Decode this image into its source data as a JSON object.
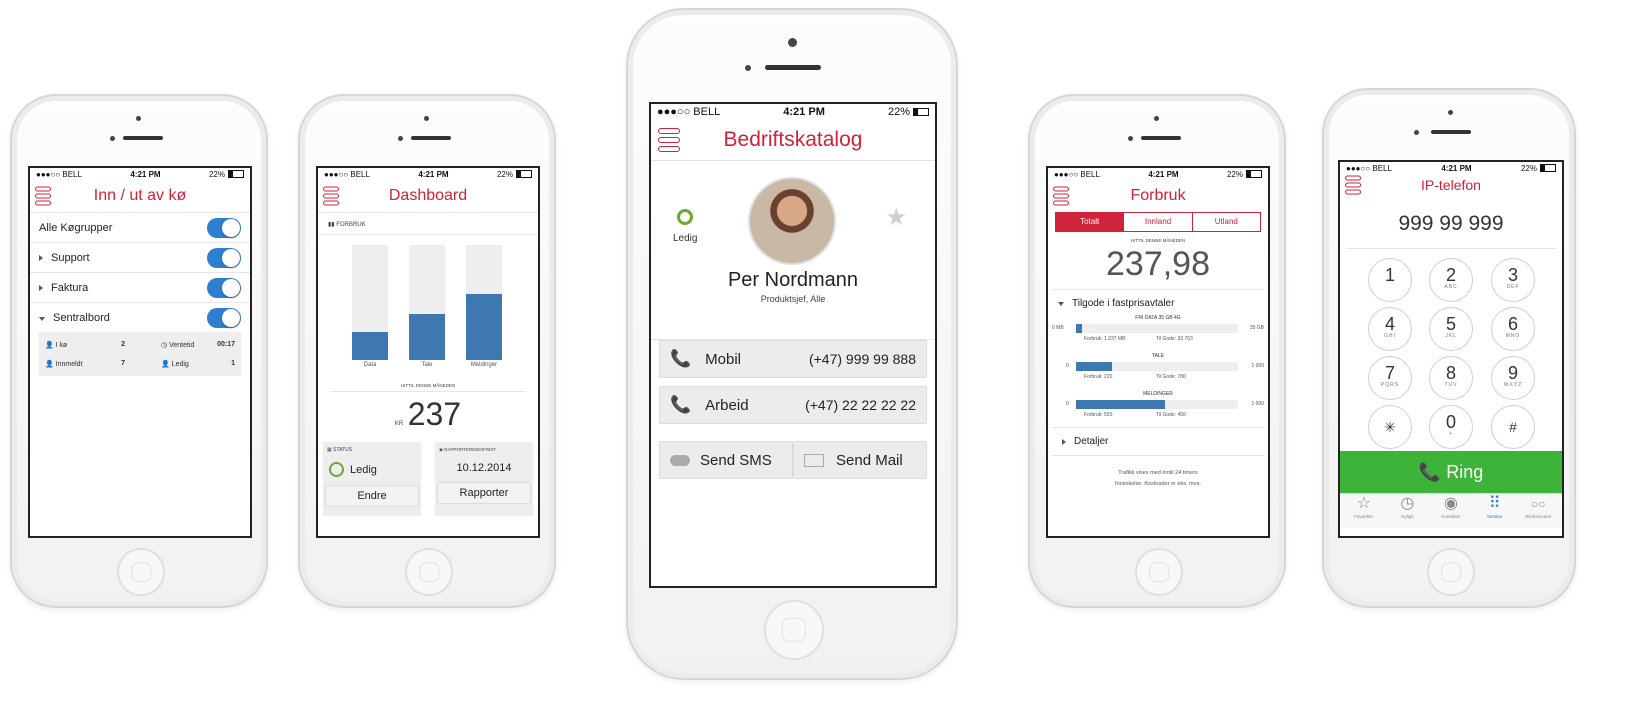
{
  "colors": {
    "brand_red": "#d0223a",
    "toggle_blue": "#2f7fd0",
    "bar_blue": "#3d78b0",
    "ring_green": "#3db33a",
    "presence_green": "#6aa830"
  },
  "statusbar": {
    "carrier": "●●●○○ BELL",
    "time": "4:21 PM",
    "battery": "22%"
  },
  "phone1": {
    "title": "Inn / ut av kø",
    "rows": [
      {
        "label": "Alle Køgrupper",
        "expander": "none",
        "on": true
      },
      {
        "label": "Support",
        "expander": "right",
        "on": true
      },
      {
        "label": "Faktura",
        "expander": "right",
        "on": true
      },
      {
        "label": "Sentralbord",
        "expander": "down",
        "on": true
      }
    ],
    "stats": [
      {
        "icon": "person-icon",
        "label": "I kø",
        "value": "2"
      },
      {
        "icon": "clock-icon",
        "label": "Ventetid",
        "value": "00:17"
      },
      {
        "icon": "person-icon",
        "label": "Innmeldt",
        "value": "7"
      },
      {
        "icon": "person-icon",
        "label": "Ledig",
        "value": "1"
      }
    ]
  },
  "phone2": {
    "title": "Dashboard",
    "section": "FORBRUK",
    "bars": [
      {
        "label": "Data",
        "fill": 0.24
      },
      {
        "label": "Tale",
        "fill": 0.4
      },
      {
        "label": "Meldinger",
        "fill": 0.57
      }
    ],
    "period": "HITTIL DENNE MÅNEDEN",
    "currency": "KR",
    "amount": "237",
    "status_label": "STATUS",
    "status_value": "Ledig",
    "status_button": "Endre",
    "deadline_label": "RAPPORTERINGSFRIST",
    "deadline_value": "10.12.2014",
    "deadline_button": "Rapporter"
  },
  "phone3": {
    "title": "Bedriftskatalog",
    "presence": "Ledig",
    "name": "Per Nordmann",
    "role": "Produktsjef, Alle",
    "contacts": [
      {
        "label": "Mobil",
        "number": "(+47) 999 99 888",
        "icon": "phone-icon"
      },
      {
        "label": "Arbeid",
        "number": "(+47) 22 22 22 22",
        "icon": "phone-icon"
      }
    ],
    "send_sms": "Send SMS",
    "send_mail": "Send Mail"
  },
  "phone4": {
    "title": "Forbruk",
    "tabs": [
      "Totalt",
      "Innland",
      "Utland"
    ],
    "active_tab": "Totalt",
    "period": "HITTIL DENNE MÅNEDEN",
    "amount": "237,98",
    "section": "Tilgode i fastprisavtaler",
    "meters": [
      {
        "title": "FRI DATA 35 GB 4G",
        "min": "0 MB",
        "max": "35 GB",
        "fill": 0.035,
        "used": "Forbruk: 1 237 MB",
        "left": "Til Gode: 33 763"
      },
      {
        "title": "TALE",
        "min": "0",
        "max": "1 000",
        "fill": 0.22,
        "used": "Forbruk: 220",
        "left": "Til Gode: 780"
      },
      {
        "title": "MELDINGER",
        "min": "0",
        "max": "1 000",
        "fill": 0.55,
        "used": "Forbruk: 550",
        "left": "Til Gode: 450"
      }
    ],
    "details": "Detaljer",
    "footnote_1": "Trafikk vises med inntil 24 timers",
    "footnote_2": "forsinkelse. Kostnader er eks. mva."
  },
  "phone5": {
    "title": "IP-telefon",
    "number": "999 99 999",
    "keys": [
      {
        "n": "1",
        "l": ""
      },
      {
        "n": "2",
        "l": "ABC"
      },
      {
        "n": "3",
        "l": "DEF"
      },
      {
        "n": "4",
        "l": "GHI"
      },
      {
        "n": "5",
        "l": "JKL"
      },
      {
        "n": "6",
        "l": "MNO"
      },
      {
        "n": "7",
        "l": "PQRS"
      },
      {
        "n": "8",
        "l": "TUV"
      },
      {
        "n": "9",
        "l": "WXYZ"
      },
      {
        "n": "✳",
        "l": ""
      },
      {
        "n": "0",
        "l": "+"
      },
      {
        "n": "#",
        "l": ""
      }
    ],
    "ring": "Ring",
    "tabs": [
      {
        "label": "Favoritter",
        "icon": "star-icon",
        "glyph": "☆"
      },
      {
        "label": "Nylige",
        "icon": "clock-icon",
        "glyph": "◷"
      },
      {
        "label": "Kontakter",
        "icon": "contacts-icon",
        "glyph": "◉"
      },
      {
        "label": "Tastatur",
        "icon": "keypad-icon",
        "glyph": "⠿"
      },
      {
        "label": "Telefonsvarer",
        "icon": "voicemail-icon",
        "glyph": "○○"
      }
    ],
    "active_tab": "Tastatur"
  }
}
